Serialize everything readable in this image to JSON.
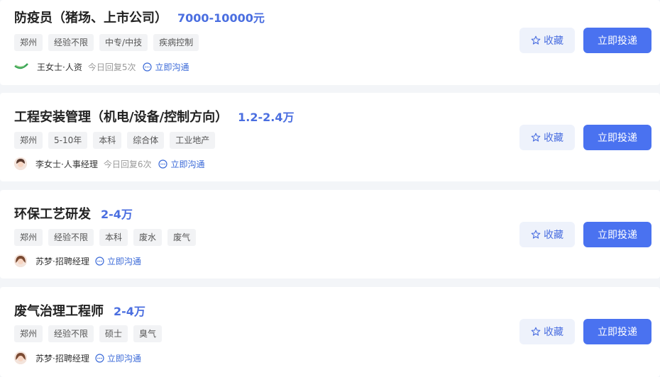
{
  "jobs": [
    {
      "title": "防疫员（猪场、上市公司）",
      "salary": "7000-10000元",
      "tags": [
        "郑州",
        "经验不限",
        "中专/中技",
        "疾病控制"
      ],
      "recruiter": "王女士·人资",
      "reply": "今日回复5次",
      "chat": "立即沟通",
      "favorite": "收藏",
      "apply": "立即投递",
      "avatar_icon": "company-logo-icon"
    },
    {
      "title": "工程安装管理（机电/设备/控制方向）",
      "salary": "1.2-2.4万",
      "tags": [
        "郑州",
        "5-10年",
        "本科",
        "综合体",
        "工业地产"
      ],
      "recruiter": "李女士·人事经理",
      "reply": "今日回复6次",
      "chat": "立即沟通",
      "favorite": "收藏",
      "apply": "立即投递",
      "avatar_icon": "person-avatar-icon"
    },
    {
      "title": "环保工艺研发",
      "salary": "2-4万",
      "tags": [
        "郑州",
        "经验不限",
        "本科",
        "废水",
        "废气"
      ],
      "recruiter": "苏梦·招聘经理",
      "reply": "",
      "chat": "立即沟通",
      "favorite": "收藏",
      "apply": "立即投递",
      "avatar_icon": "person-avatar-icon"
    },
    {
      "title": "废气治理工程师",
      "salary": "2-4万",
      "tags": [
        "郑州",
        "经验不限",
        "硕士",
        "臭气"
      ],
      "recruiter": "苏梦·招聘经理",
      "reply": "",
      "chat": "立即沟通",
      "favorite": "收藏",
      "apply": "立即投递",
      "avatar_icon": "person-avatar-icon"
    }
  ],
  "colors": {
    "accent": "#4a72f0",
    "salary": "#4a6ee0",
    "link": "#3b6ad8",
    "background": "#f3f5f8"
  }
}
